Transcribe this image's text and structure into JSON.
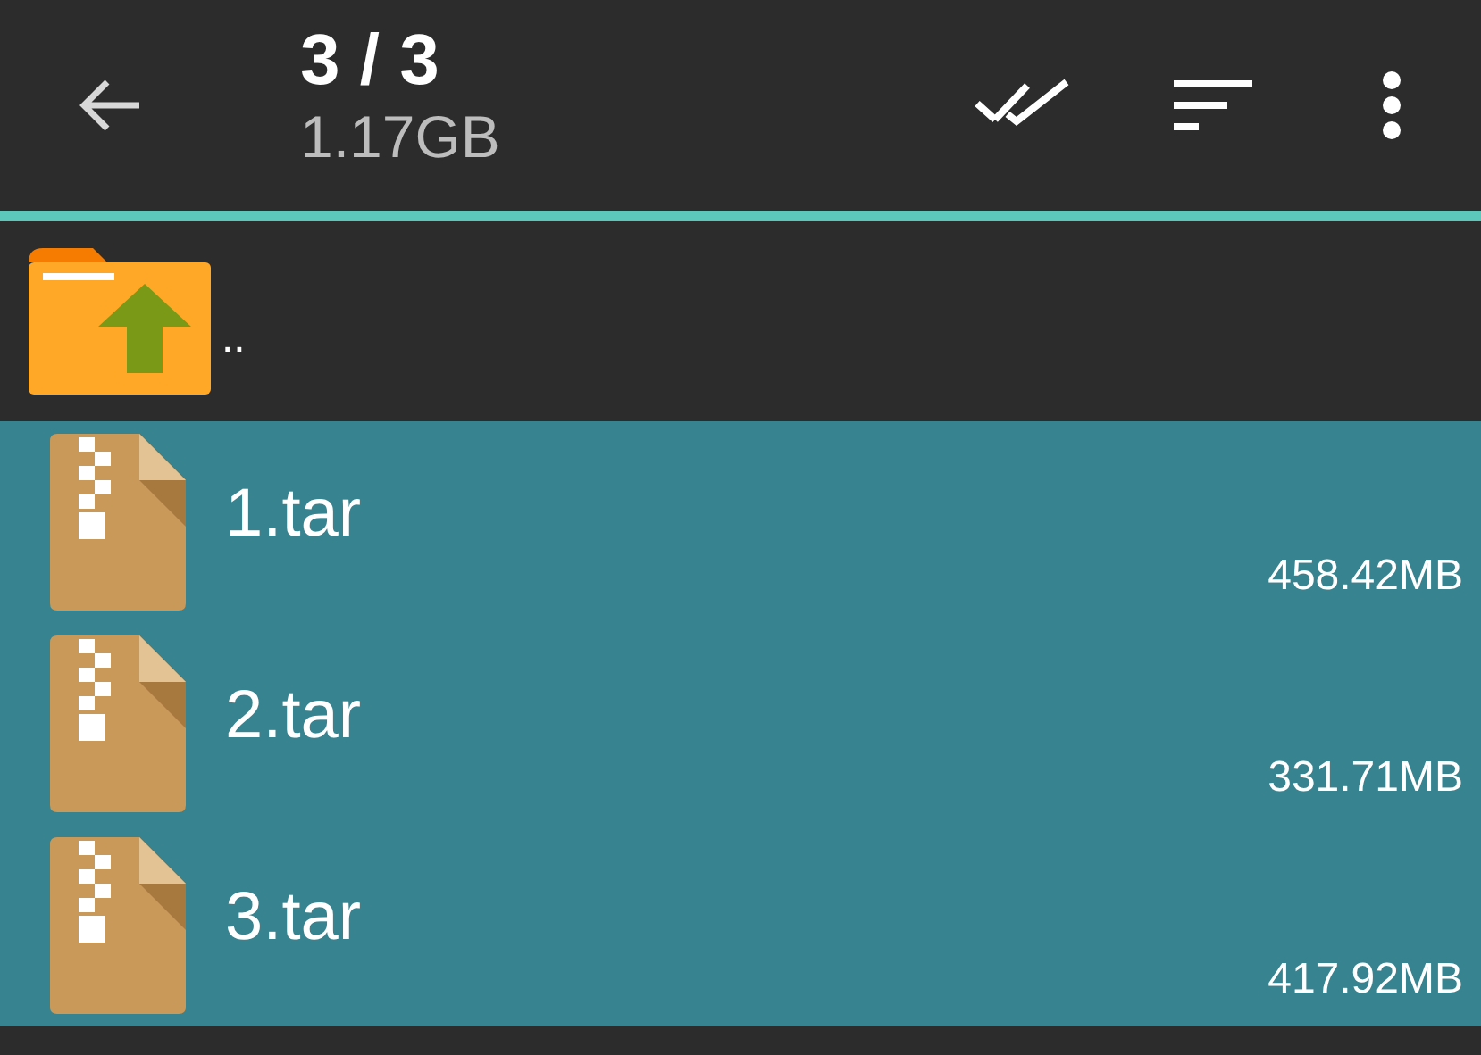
{
  "toolbar": {
    "title": "3 / 3",
    "subtitle": "1.17GB"
  },
  "parent_row": {
    "label": ".."
  },
  "files": [
    {
      "name": "1.tar",
      "size": "458.42MB",
      "selected": true
    },
    {
      "name": "2.tar",
      "size": "331.71MB",
      "selected": true
    },
    {
      "name": "3.tar",
      "size": "417.92MB",
      "selected": true
    }
  ]
}
